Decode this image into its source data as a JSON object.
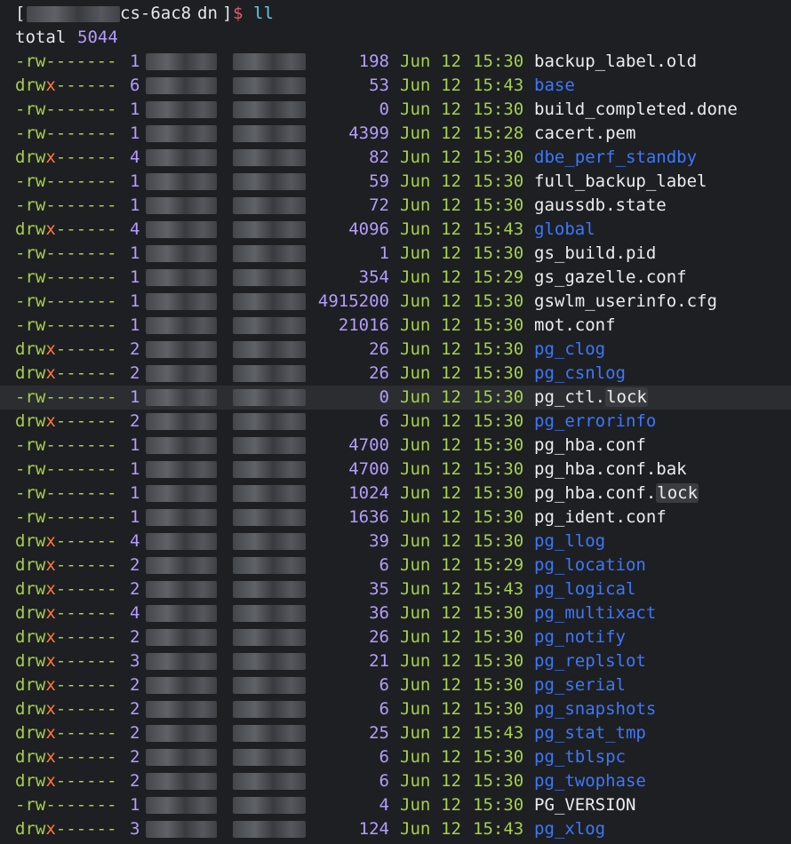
{
  "prompt": {
    "open_bracket": "[",
    "host_suffix": "cs-6ac8",
    "dir": "dn",
    "close_bracket": "]",
    "symbol": "$",
    "command": "ll"
  },
  "total": {
    "label": "total",
    "value": "5044"
  },
  "rows": [
    {
      "perm": "-rw-------",
      "links": "1",
      "size": "198",
      "month": "Jun",
      "day": "12",
      "time": "15:30",
      "name": "backup_label.old",
      "dir": false
    },
    {
      "perm": "drwx------",
      "links": "6",
      "size": "53",
      "month": "Jun",
      "day": "12",
      "time": "15:43",
      "name": "base",
      "dir": true
    },
    {
      "perm": "-rw-------",
      "links": "1",
      "size": "0",
      "month": "Jun",
      "day": "12",
      "time": "15:30",
      "name": "build_completed.done",
      "dir": false
    },
    {
      "perm": "-rw-------",
      "links": "1",
      "size": "4399",
      "month": "Jun",
      "day": "12",
      "time": "15:28",
      "name": "cacert.pem",
      "dir": false
    },
    {
      "perm": "drwx------",
      "links": "4",
      "size": "82",
      "month": "Jun",
      "day": "12",
      "time": "15:30",
      "name": "dbe_perf_standby",
      "dir": true
    },
    {
      "perm": "-rw-------",
      "links": "1",
      "size": "59",
      "month": "Jun",
      "day": "12",
      "time": "15:30",
      "name": "full_backup_label",
      "dir": false
    },
    {
      "perm": "-rw-------",
      "links": "1",
      "size": "72",
      "month": "Jun",
      "day": "12",
      "time": "15:30",
      "name": "gaussdb.state",
      "dir": false
    },
    {
      "perm": "drwx------",
      "links": "4",
      "size": "4096",
      "month": "Jun",
      "day": "12",
      "time": "15:43",
      "name": "global",
      "dir": true
    },
    {
      "perm": "-rw-------",
      "links": "1",
      "size": "1",
      "month": "Jun",
      "day": "12",
      "time": "15:30",
      "name": "gs_build.pid",
      "dir": false
    },
    {
      "perm": "-rw-------",
      "links": "1",
      "size": "354",
      "month": "Jun",
      "day": "12",
      "time": "15:29",
      "name": "gs_gazelle.conf",
      "dir": false
    },
    {
      "perm": "-rw-------",
      "links": "1",
      "size": "4915200",
      "month": "Jun",
      "day": "12",
      "time": "15:30",
      "name": "gswlm_userinfo.cfg",
      "dir": false
    },
    {
      "perm": "-rw-------",
      "links": "1",
      "size": "21016",
      "month": "Jun",
      "day": "12",
      "time": "15:30",
      "name": "mot.conf",
      "dir": false
    },
    {
      "perm": "drwx------",
      "links": "2",
      "size": "26",
      "month": "Jun",
      "day": "12",
      "time": "15:30",
      "name": "pg_clog",
      "dir": true
    },
    {
      "perm": "drwx------",
      "links": "2",
      "size": "26",
      "month": "Jun",
      "day": "12",
      "time": "15:30",
      "name": "pg_csnlog",
      "dir": true
    },
    {
      "perm": "-rw-------",
      "links": "1",
      "size": "0",
      "month": "Jun",
      "day": "12",
      "time": "15:30",
      "name": "pg_ctl.",
      "suffix": "lock",
      "dir": false,
      "highlight": true
    },
    {
      "perm": "drwx------",
      "links": "2",
      "size": "6",
      "month": "Jun",
      "day": "12",
      "time": "15:30",
      "name": "pg_errorinfo",
      "dir": true
    },
    {
      "perm": "-rw-------",
      "links": "1",
      "size": "4700",
      "month": "Jun",
      "day": "12",
      "time": "15:30",
      "name": "pg_hba.conf",
      "dir": false
    },
    {
      "perm": "-rw-------",
      "links": "1",
      "size": "4700",
      "month": "Jun",
      "day": "12",
      "time": "15:30",
      "name": "pg_hba.conf.bak",
      "dir": false
    },
    {
      "perm": "-rw-------",
      "links": "1",
      "size": "1024",
      "month": "Jun",
      "day": "12",
      "time": "15:30",
      "name": "pg_hba.conf.",
      "suffix": "lock",
      "dir": false
    },
    {
      "perm": "-rw-------",
      "links": "1",
      "size": "1636",
      "month": "Jun",
      "day": "12",
      "time": "15:30",
      "name": "pg_ident.conf",
      "dir": false
    },
    {
      "perm": "drwx------",
      "links": "4",
      "size": "39",
      "month": "Jun",
      "day": "12",
      "time": "15:30",
      "name": "pg_llog",
      "dir": true
    },
    {
      "perm": "drwx------",
      "links": "2",
      "size": "6",
      "month": "Jun",
      "day": "12",
      "time": "15:29",
      "name": "pg_location",
      "dir": true
    },
    {
      "perm": "drwx------",
      "links": "2",
      "size": "35",
      "month": "Jun",
      "day": "12",
      "time": "15:43",
      "name": "pg_logical",
      "dir": true
    },
    {
      "perm": "drwx------",
      "links": "4",
      "size": "36",
      "month": "Jun",
      "day": "12",
      "time": "15:30",
      "name": "pg_multixact",
      "dir": true
    },
    {
      "perm": "drwx------",
      "links": "2",
      "size": "26",
      "month": "Jun",
      "day": "12",
      "time": "15:30",
      "name": "pg_notify",
      "dir": true
    },
    {
      "perm": "drwx------",
      "links": "3",
      "size": "21",
      "month": "Jun",
      "day": "12",
      "time": "15:30",
      "name": "pg_replslot",
      "dir": true
    },
    {
      "perm": "drwx------",
      "links": "2",
      "size": "6",
      "month": "Jun",
      "day": "12",
      "time": "15:30",
      "name": "pg_serial",
      "dir": true
    },
    {
      "perm": "drwx------",
      "links": "2",
      "size": "6",
      "month": "Jun",
      "day": "12",
      "time": "15:30",
      "name": "pg_snapshots",
      "dir": true
    },
    {
      "perm": "drwx------",
      "links": "2",
      "size": "25",
      "month": "Jun",
      "day": "12",
      "time": "15:43",
      "name": "pg_stat_tmp",
      "dir": true
    },
    {
      "perm": "drwx------",
      "links": "2",
      "size": "6",
      "month": "Jun",
      "day": "12",
      "time": "15:30",
      "name": "pg_tblspc",
      "dir": true
    },
    {
      "perm": "drwx------",
      "links": "2",
      "size": "6",
      "month": "Jun",
      "day": "12",
      "time": "15:30",
      "name": "pg_twophase",
      "dir": true
    },
    {
      "perm": "-rw-------",
      "links": "1",
      "size": "4",
      "month": "Jun",
      "day": "12",
      "time": "15:30",
      "name": "PG_VERSION",
      "dir": false
    },
    {
      "perm": "drwx------",
      "links": "3",
      "size": "124",
      "month": "Jun",
      "day": "12",
      "time": "15:43",
      "name": "pg_xlog",
      "dir": true
    }
  ]
}
